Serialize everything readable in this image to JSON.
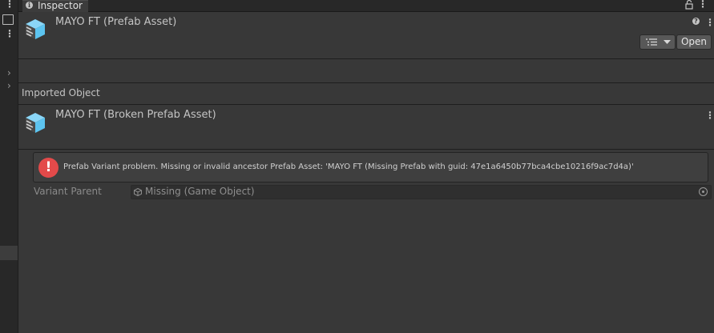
{
  "tab": {
    "title": "Inspector"
  },
  "header": {
    "title": "MAYO FT (Prefab Asset)",
    "open_label": "Open"
  },
  "imported": {
    "section_label": "Imported Object",
    "title": "MAYO FT (Broken Prefab Asset)"
  },
  "help": {
    "message": "Prefab Variant problem. Missing or invalid ancestor Prefab Asset: 'MAYO FT (Missing Prefab with guid: 47e1a6450b77bca4cbe10216f9ac7d4a)'"
  },
  "variant_parent": {
    "label": "Variant Parent",
    "value": "Missing (Game Object)"
  },
  "colors": {
    "background": "#383838",
    "error": "#e34a4a",
    "cube": "#5cc4f0"
  }
}
